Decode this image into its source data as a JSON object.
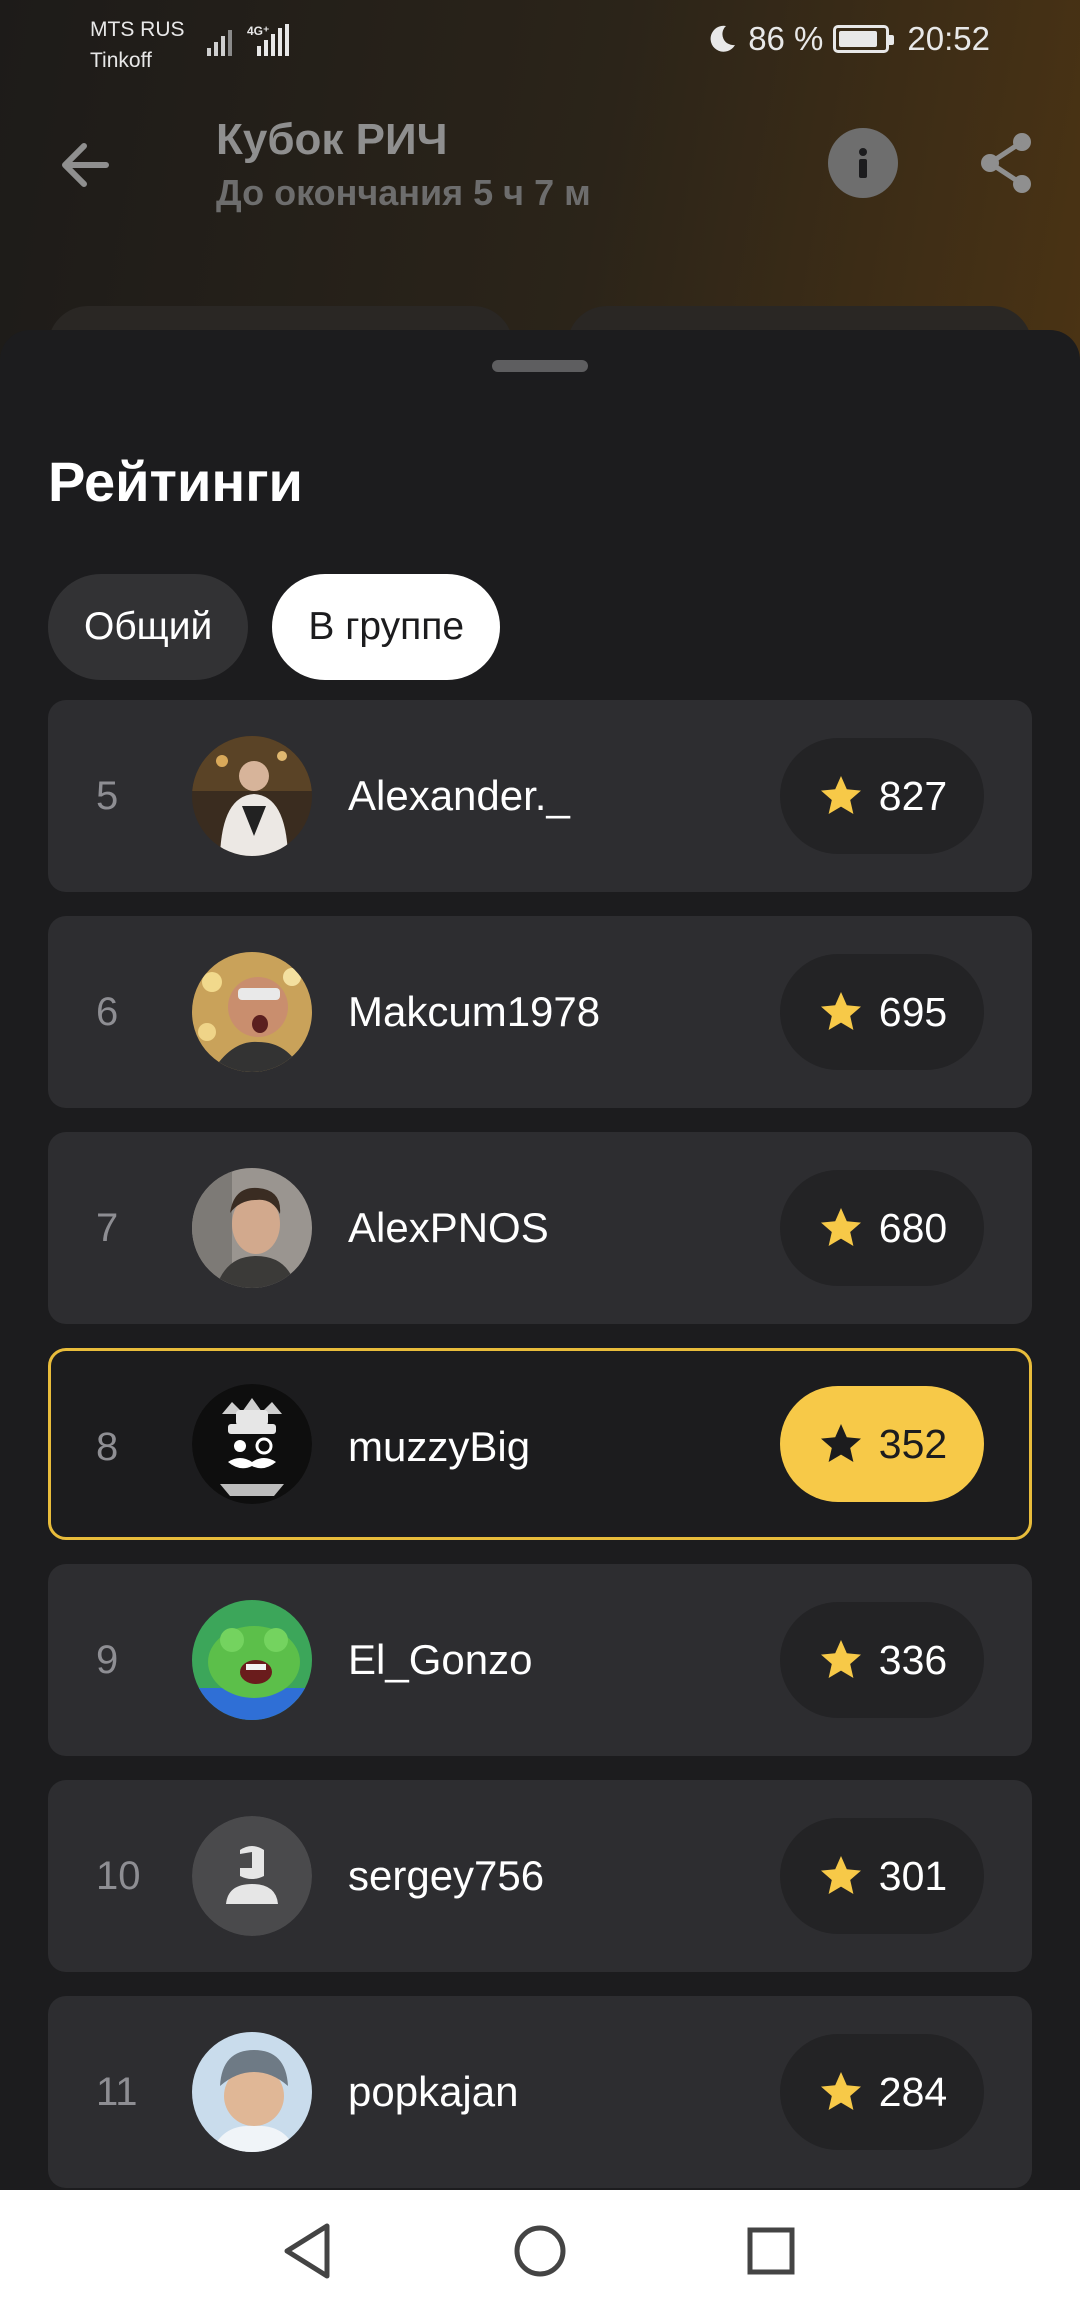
{
  "status_bar": {
    "carrier_line1": "MTS RUS",
    "carrier_line2": "Tinkoff",
    "network": "4G⁺",
    "battery": "86 %",
    "battery_level": 0.86,
    "time": "20:52"
  },
  "header": {
    "title": "Кубок РИЧ",
    "subtitle": "До окончания 5 ч 7 м"
  },
  "sheet": {
    "title": "Рейтинги",
    "tabs": [
      {
        "label": "Общий",
        "active": false
      },
      {
        "label": "В группе",
        "active": true
      }
    ]
  },
  "rankings": [
    {
      "rank": "5",
      "name": "Alexander._",
      "score": "827",
      "avatar": "photo-avatar"
    },
    {
      "rank": "6",
      "name": "Makcum1978",
      "score": "695",
      "avatar": "photo-avatar"
    },
    {
      "rank": "7",
      "name": "AlexPNOS",
      "score": "680",
      "avatar": "photo-avatar"
    },
    {
      "rank": "8",
      "name": "muzzyBig",
      "score": "352",
      "avatar": "emblem-avatar",
      "current_user": true
    },
    {
      "rank": "9",
      "name": "El_Gonzo",
      "score": "336",
      "avatar": "frog-avatar"
    },
    {
      "rank": "10",
      "name": "sergey756",
      "score": "301",
      "avatar": "default-user-avatar"
    },
    {
      "rank": "11",
      "name": "popkajan",
      "score": "284",
      "avatar": "photo-avatar"
    }
  ],
  "colors": {
    "accent": "#f7c948",
    "highlight_border": "#e8bc3b",
    "background": "#1c1c1e",
    "card": "#2d2d30"
  },
  "icons": {
    "back": "arrow-left-icon",
    "info": "info-icon",
    "share": "share-icon",
    "score": "star-icon",
    "nav": [
      "back-triangle-icon",
      "home-circle-icon",
      "recents-square-icon"
    ]
  }
}
